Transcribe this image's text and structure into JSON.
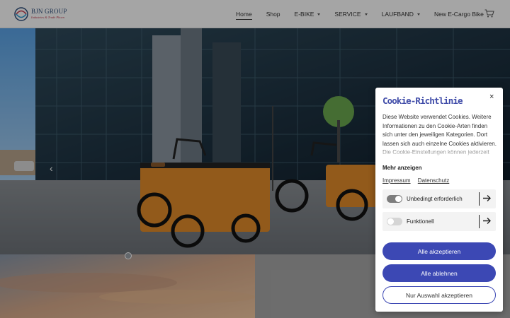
{
  "header": {
    "logo_text": "BJN GROUP",
    "logo_subtext": "Industries & Trade Phoen",
    "nav": [
      {
        "label": "Home",
        "active": true,
        "dropdown": false
      },
      {
        "label": "Shop",
        "active": false,
        "dropdown": false
      },
      {
        "label": "E-BIKE",
        "active": false,
        "dropdown": true
      },
      {
        "label": "SERVICE",
        "active": false,
        "dropdown": true
      },
      {
        "label": "LAUFBAND",
        "active": false,
        "dropdown": true
      },
      {
        "label": "New E-Cargo Bike",
        "active": false,
        "dropdown": false
      }
    ],
    "cart_icon": "cart-icon"
  },
  "hero": {
    "prev_arrow": "‹"
  },
  "cookie": {
    "title": "Cookie-Richtlinie",
    "close": "×",
    "description": "Diese Website verwendet Cookies. Weitere Informationen zu den Cookie-Arten finden sich unter den jeweiligen Kategorien. Dort lassen sich auch einzelne Cookies aktivieren. Die Cookie-Einstellungen können jederzeit",
    "more_label": "Mehr anzeigen",
    "links": [
      "Impressum",
      "Datenschutz"
    ],
    "categories": [
      {
        "label": "Unbedingt erforderlich",
        "enabled": true
      },
      {
        "label": "Funktionell",
        "enabled": false
      }
    ],
    "accept_all": "Alle akzeptieren",
    "reject_all": "Alle ablehnen",
    "accept_selection": "Nur Auswahl akzeptieren"
  },
  "colors": {
    "accent": "#3c48b4",
    "title": "#3f4ba8"
  }
}
